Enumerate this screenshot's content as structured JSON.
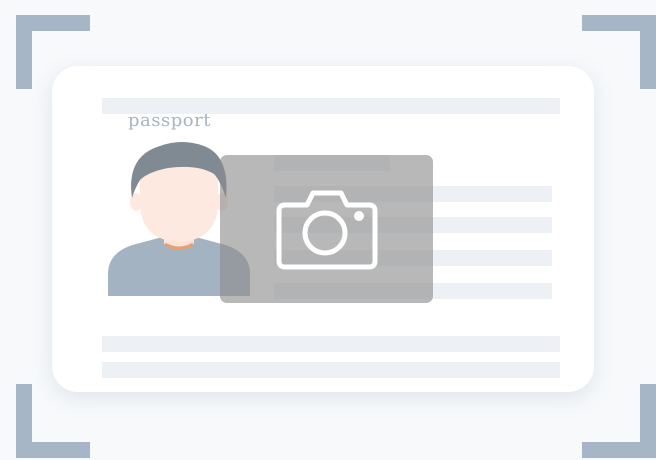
{
  "card": {
    "label": "passport"
  },
  "icons": {
    "camera": "camera-icon",
    "portrait": "person-portrait-icon"
  },
  "colors": {
    "frame_corner": "#a6b6c6",
    "card_background": "#ffffff",
    "placeholder_line": "#edf1f5",
    "overlay": "#8c8c8c",
    "hair": "#7f8a93",
    "skin": "#fde9df",
    "shirt": "#a3b3c2"
  }
}
